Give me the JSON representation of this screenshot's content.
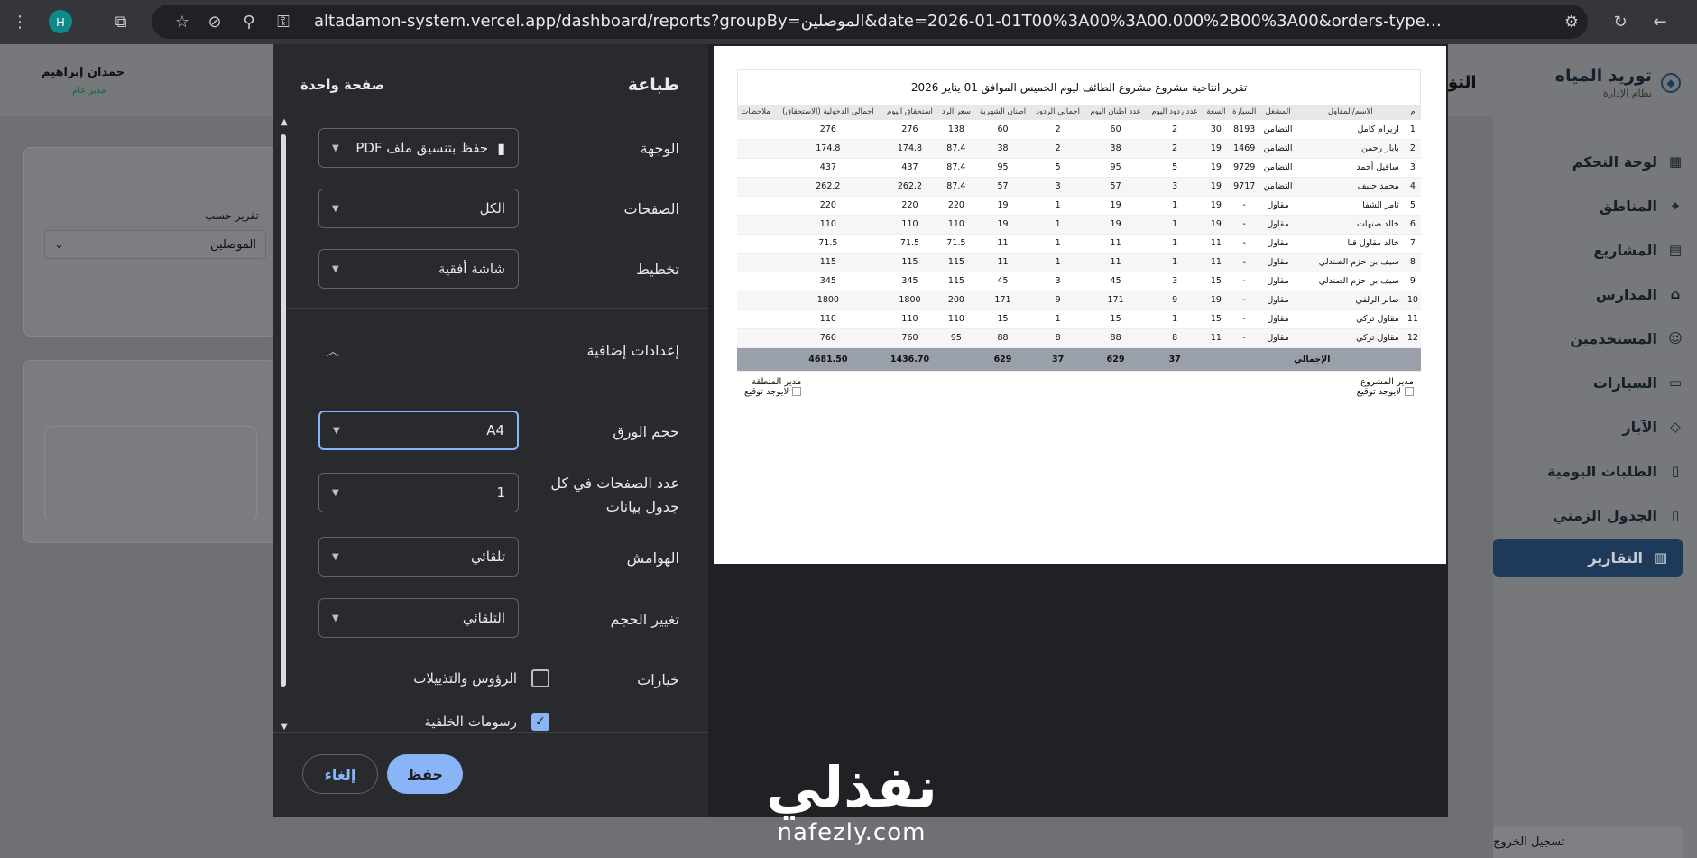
{
  "browser": {
    "profile_initial": "H",
    "url": "altadamon-system.vercel.app/dashboard/reports?groupBy=الموصلين&date=2026-01-01T00%3A00%3A00.000%2B00%3A00&orders-type=توريد&report=تقرير+شهري&region=..."
  },
  "app": {
    "brand_title": "توريد المياه",
    "brand_sub": "نظام الإدارة",
    "user_name": "حمدان إبراهيم",
    "user_role": "مدير عام",
    "page_title_peek": "التق",
    "nav": [
      {
        "label": "لوحة التحكم",
        "icon": "dashboard-icon"
      },
      {
        "label": "المناطق",
        "icon": "map-pin-icon"
      },
      {
        "label": "المشاريع",
        "icon": "projects-icon"
      },
      {
        "label": "المدارس",
        "icon": "school-icon"
      },
      {
        "label": "المستخدمين",
        "icon": "users-icon"
      },
      {
        "label": "السيارات",
        "icon": "truck-icon"
      },
      {
        "label": "الآبار",
        "icon": "drop-icon"
      },
      {
        "label": "الطلبات اليومية",
        "icon": "clipboard-icon"
      },
      {
        "label": "الجدول الزمني",
        "icon": "schedule-icon"
      },
      {
        "label": "التقارير",
        "icon": "chart-icon"
      }
    ],
    "logout": "تسجيل الخروج",
    "filter_label": "تقرير حسب",
    "filter_value": "الموصلين"
  },
  "print": {
    "title": "طباعة",
    "pages_summary": "صفحة واحدة",
    "destination_label": "الوجهة",
    "destination_value": "حفظ بتنسيق ملف PDF",
    "pages_label": "الصفحات",
    "pages_value": "الكل",
    "layout_label": "تخطيط",
    "layout_value": "شاشة أفقية",
    "more_settings": "إعدادات إضافية",
    "paper_label": "حجم الورق",
    "paper_value": "A4",
    "per_sheet_label": "عدد الصفحات في كل جدول بيانات",
    "per_sheet_value": "1",
    "margins_label": "الهوامش",
    "margins_value": "تلقائي",
    "scale_label": "تغيير الحجم",
    "scale_value": "التلقائي",
    "options_label": "خيارات",
    "opt_headers": "الرؤوس والتذييلات",
    "opt_headers_checked": false,
    "opt_background": "رسومات الخلفية",
    "opt_background_checked": true,
    "save": "حفظ",
    "cancel": "إلغاء"
  },
  "report": {
    "title": "تقرير انتاجية مشروع مشروع الطائف ليوم الخميس الموافق 01 يناير 2026",
    "headers": [
      "م",
      "الاسم/المقاول",
      "المشغل",
      "السيارة",
      "السعة",
      "عدد ردود اليوم",
      "عدد اطنان اليوم",
      "اجمالي الردود",
      "اطنان الشهرية",
      "سعر الرد",
      "استحقاق اليوم",
      "اجمالي الدخولية (الاستحقاق)",
      "ملاحظات"
    ],
    "rows": [
      [
        "1",
        "اريرام كامل",
        "التضامن",
        "8193",
        "30",
        "2",
        "60",
        "2",
        "60",
        "138",
        "276",
        "276",
        ""
      ],
      [
        "2",
        "بابار رحمن",
        "التضامن",
        "1469",
        "19",
        "2",
        "38",
        "2",
        "38",
        "87.4",
        "174.8",
        "174.8",
        ""
      ],
      [
        "3",
        "ساقيل أحمد",
        "التضامن",
        "9729",
        "19",
        "5",
        "95",
        "5",
        "95",
        "87.4",
        "437",
        "437",
        ""
      ],
      [
        "4",
        "محمد حنيف",
        "التضامن",
        "9717",
        "19",
        "3",
        "57",
        "3",
        "57",
        "87.4",
        "262.2",
        "262.2",
        ""
      ],
      [
        "5",
        "ثامر الشفا",
        "مقاول",
        "-",
        "19",
        "1",
        "19",
        "1",
        "19",
        "220",
        "220",
        "220",
        ""
      ],
      [
        "6",
        "خالد صنهات",
        "مقاول",
        "-",
        "19",
        "1",
        "19",
        "1",
        "19",
        "110",
        "110",
        "110",
        ""
      ],
      [
        "7",
        "خالد مقاول قبا",
        "مقاول",
        "-",
        "11",
        "1",
        "11",
        "1",
        "11",
        "71.5",
        "71.5",
        "71.5",
        ""
      ],
      [
        "8",
        "سيف بن حزم الصندلي",
        "مقاول",
        "-",
        "11",
        "1",
        "11",
        "1",
        "11",
        "115",
        "115",
        "115",
        ""
      ],
      [
        "9",
        "سيف بن حزم الصندلي",
        "مقاول",
        "-",
        "15",
        "3",
        "45",
        "3",
        "45",
        "115",
        "345",
        "345",
        ""
      ],
      [
        "10",
        "صابر الرلفي",
        "مقاول",
        "-",
        "19",
        "9",
        "171",
        "9",
        "171",
        "200",
        "1800",
        "1800",
        ""
      ],
      [
        "11",
        "مقاول تركي",
        "مقاول",
        "-",
        "15",
        "1",
        "15",
        "1",
        "15",
        "110",
        "110",
        "110",
        ""
      ],
      [
        "12",
        "مقاول تركي",
        "مقاول",
        "-",
        "11",
        "8",
        "88",
        "8",
        "88",
        "95",
        "760",
        "760",
        ""
      ]
    ],
    "total_label": "الإجمالي",
    "total": {
      "daily_trips": "37",
      "daily_tons": "629",
      "total_trips": "37",
      "monthly_tons": "629",
      "daily_due": "1436.70",
      "total_due": "4681.50"
    },
    "project_manager": "مدير المشروع",
    "region_manager": "مدير المنطقة",
    "no_signature": "لايوجد توقيع"
  },
  "watermark": {
    "ar": "نفذلي",
    "en": "nafezly.com"
  }
}
